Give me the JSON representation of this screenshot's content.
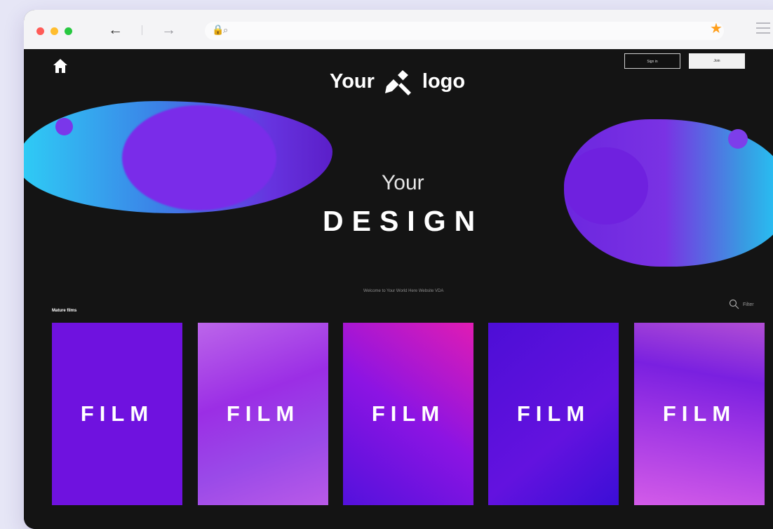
{
  "browser": {
    "back_icon": "←",
    "forward_icon": "→",
    "lock_icon": "🔒",
    "search_icon": "⌕",
    "bookmark_icon": "★"
  },
  "header": {
    "home_icon": "home",
    "logo_before": "Your",
    "logo_after": "logo",
    "sign_in_label": "Sign in",
    "auth_label": "Join"
  },
  "hero": {
    "small": "Your",
    "large": "DESIGN",
    "welcome": "Welcome to Your World Here Website VDA"
  },
  "films": {
    "section_title": "Mature films",
    "filter_label": "Filter",
    "cards": [
      "FILM",
      "FILM",
      "FILM",
      "FILM",
      "FILM"
    ]
  },
  "colors": {
    "page_bg": "#e6e6f6",
    "site_bg": "#141414",
    "accent_purple": "#6f12df",
    "accent_pink": "#e01cb3"
  }
}
